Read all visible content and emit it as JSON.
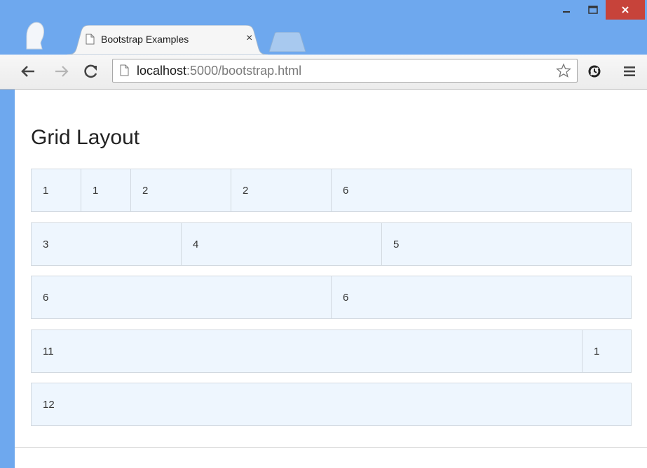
{
  "browser": {
    "tab_title": "Bootstrap Examples",
    "tab_close": "×",
    "url_host": "localhost",
    "url_rest": ":5000/bootstrap.html"
  },
  "page": {
    "title": "Grid Layout",
    "rows": [
      {
        "cells": [
          {
            "label": "1",
            "span": 1
          },
          {
            "label": "1",
            "span": 1
          },
          {
            "label": "2",
            "span": 2
          },
          {
            "label": "2",
            "span": 2
          },
          {
            "label": "6",
            "span": 6
          }
        ]
      },
      {
        "cells": [
          {
            "label": "3",
            "span": 3
          },
          {
            "label": "4",
            "span": 4
          },
          {
            "label": "5",
            "span": 5
          }
        ]
      },
      {
        "cells": [
          {
            "label": "6",
            "span": 6
          },
          {
            "label": "6",
            "span": 6
          }
        ]
      },
      {
        "cells": [
          {
            "label": "11",
            "span": 11
          },
          {
            "label": "1",
            "span": 1
          }
        ]
      },
      {
        "cells": [
          {
            "label": "12",
            "span": 12
          }
        ]
      }
    ]
  },
  "colors": {
    "cell_background": "#eef6fe",
    "cell_border": "#d2d9e0",
    "titlebar": "#6ea8ee",
    "close_button": "#c7433a"
  },
  "icons": {
    "back": "back-arrow-icon",
    "forward": "forward-arrow-icon",
    "reload": "reload-icon",
    "page": "page-icon",
    "bookmark": "star-icon",
    "extension": "extension-icon",
    "menu": "menu-icon"
  }
}
